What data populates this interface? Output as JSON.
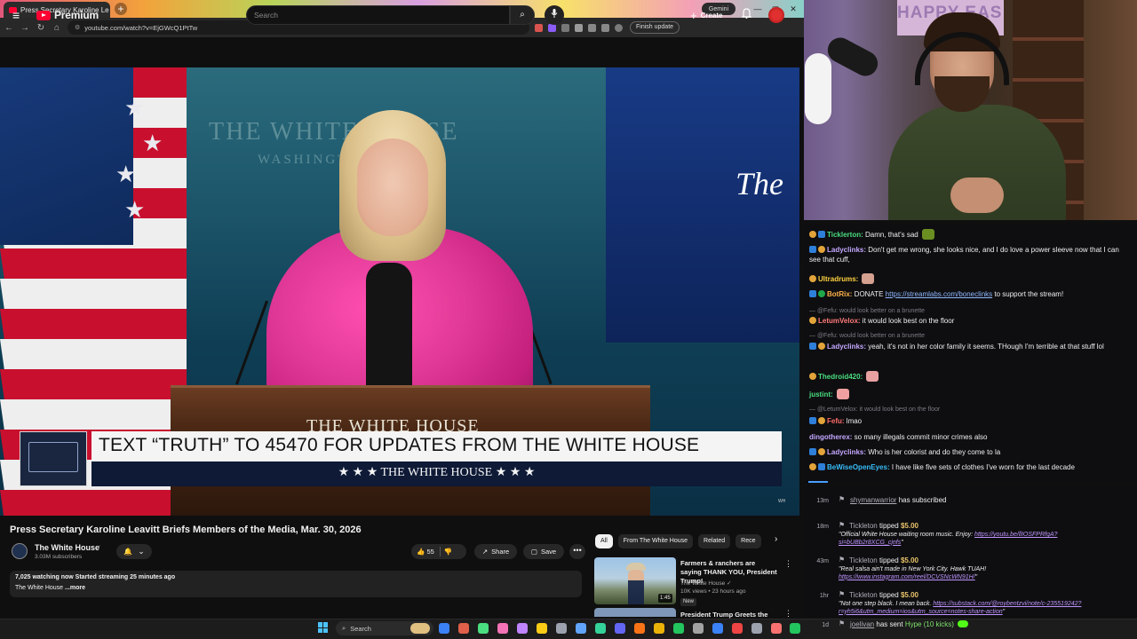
{
  "browser": {
    "tab_title": "Press Secretary Karoline Le",
    "tab_close": "×",
    "new_tab": "+",
    "gemini": "Gemini",
    "url": "youtube.com/watch?v=EjGWcQ1PtTw",
    "finish_update": "Finish update",
    "nav_back": "←",
    "nav_forward": "→",
    "nav_reload": "↻",
    "nav_home": "⌂",
    "win_min": "—",
    "win_max": "▢",
    "win_close": "✕"
  },
  "youtube": {
    "menu_icon": "≡",
    "logo_text": "Premium",
    "search_placeholder": "Search",
    "search_icon": "⌕",
    "mic_icon": "🎙",
    "create_label": "Create",
    "create_plus": "+",
    "bell_icon": "🔔"
  },
  "video": {
    "wall_text": "THE WHITE HOUSE",
    "wall_sub": "WASHINGTON",
    "screen_text": "The",
    "podium_text": "THE WHITE HOUSE",
    "lower_third_main": "TEXT “TRUTH” TO 45470 FOR UPDATES FROM THE WHITE HOUSE",
    "lower_third_sub": "★ ★ ★   THE WHITE HOUSE   ★ ★ ★",
    "badge": "WH"
  },
  "watch": {
    "title": "Press Secretary Karoline Leavitt Briefs Members of the Media, Mar. 30, 2026",
    "channel_name": "The White House",
    "verified": "✓",
    "subscribers": "3.03M subscribers",
    "bell_label": "🔔",
    "bell_chevron": "⌄",
    "likes": "55",
    "like_icon": "👍",
    "dislike_icon": "👎",
    "share_label": "Share",
    "share_icon": "↗",
    "save_label": "Save",
    "save_icon": "▢",
    "more_icon": "•••",
    "watching": "7,025 watching now  Started streaming 25 minutes ago",
    "desc_channel": "The White House",
    "desc_more": "...more"
  },
  "chips": [
    "All",
    "From The White House",
    "Related",
    "Rece"
  ],
  "chip_next": "›",
  "related": [
    {
      "title": "Farmers & ranchers are saying THANK YOU, President Trump!",
      "channel": "The White House ✓",
      "meta": "10K views • 23 hours ago",
      "badge": "New",
      "duration": "1:45",
      "menu": "⋮"
    },
    {
      "title": "President Trump Greets the",
      "menu": "⋮"
    }
  ],
  "webcam": {
    "banner_text": "HAPPY EAS"
  },
  "chat": [
    {
      "user": "Ticklerton",
      "color": "#4ade80",
      "text": "Damn, that's sad",
      "badges": [
        "coin",
        "blue"
      ],
      "emote": "#6b8e23"
    },
    {
      "user": "Ladyclinks",
      "color": "#c4a7ff",
      "text": "Don't get me wrong, she looks nice, and I do love a power sleeve now that I can see that cuff,",
      "badges": [
        "blue",
        "coin"
      ]
    },
    {
      "user": "Ultradrums",
      "color": "#ffd23f",
      "text": "",
      "badges": [
        "coin"
      ],
      "emote": "#d4a090"
    },
    {
      "user": "BotRix",
      "color": "#ffb14a",
      "text": "DONATE ",
      "link": "https://streamlabs.com/boneclinks",
      "text_after": " to support the stream!",
      "badges": [
        "blue",
        "green"
      ]
    },
    {
      "reply": "— @Fefu: would look better on a brunette"
    },
    {
      "user": "LetumVelox",
      "color": "#ff7a7a",
      "text": "it would look best on the floor",
      "badges": [
        "coin"
      ]
    },
    {
      "reply": "— @Fefu: would look better on a brunette"
    },
    {
      "user": "Ladyclinks",
      "color": "#c4a7ff",
      "text": "yeah, it's not in her color family it seems. THough I'm terrible at that stuff lol",
      "badges": [
        "blue",
        "coin"
      ]
    },
    {
      "user": "Thedroid420",
      "color": "#4ade80",
      "text": "",
      "badges": [
        "coin"
      ],
      "emote": "#e8a0a0"
    },
    {
      "user": "justint",
      "color": "#4ade80",
      "text": "",
      "badges": [],
      "emote": "#f0a0a0"
    },
    {
      "reply": "— @LetumVelox: it would look best on the floor"
    },
    {
      "user": "Fefu",
      "color": "#ff6b6b",
      "text": "lmao",
      "badges": [
        "blue",
        "coin"
      ]
    },
    {
      "user": "dingotherex",
      "color": "#c4a7ff",
      "text": "so many illegals commit minor crimes also",
      "badges": []
    },
    {
      "user": "Ladyclinks",
      "color": "#c4a7ff",
      "text": "Who is her colorist and do they come to la",
      "badges": [
        "blue",
        "coin"
      ]
    },
    {
      "user": "BeWiseOpenEyes",
      "color": "#38bdf8",
      "text": "I have like five sets of clothes I've worn for the last decade",
      "badges": [
        "coin",
        "blue"
      ]
    }
  ],
  "events": [
    {
      "time": "13m",
      "user": "shymanwarrior",
      "text": " has subscribed"
    },
    {
      "time": "18m",
      "user": "Tickleton",
      "text": " tipped ",
      "amount": "$5.00",
      "note": "\"Official White House waiting room music. Enjoy: ",
      "note_link": "https://youtu.be/llIOSFPRfgA?si=bUBb2r8XCG_cjnfs",
      "note_end": "\""
    },
    {
      "time": "43m",
      "user": "Tickleton",
      "text": " tipped ",
      "amount": "$5.00",
      "note": "\"Real salsa ain't made in New York City. Hawk TUAH! ",
      "note_link": "https://www.instagram.com/reel/DCVSNcWN91H/",
      "note_end": "\""
    },
    {
      "time": "1hr",
      "user": "Tickleton",
      "text": " tipped ",
      "amount": "$5.00",
      "note": "\"Not one step black. I mean back. ",
      "note_link": "https://substack.com/@roybentzvi/note/c-235519242?r=yh5i6&utm_medium=ios&utm_source=notes-share-action",
      "note_end": "\""
    },
    {
      "time": "1d",
      "user": "joelivan",
      "text": " has sent ",
      "hype": "Hype (10 kicks)"
    }
  ],
  "taskbar": {
    "search_label": "Search"
  }
}
